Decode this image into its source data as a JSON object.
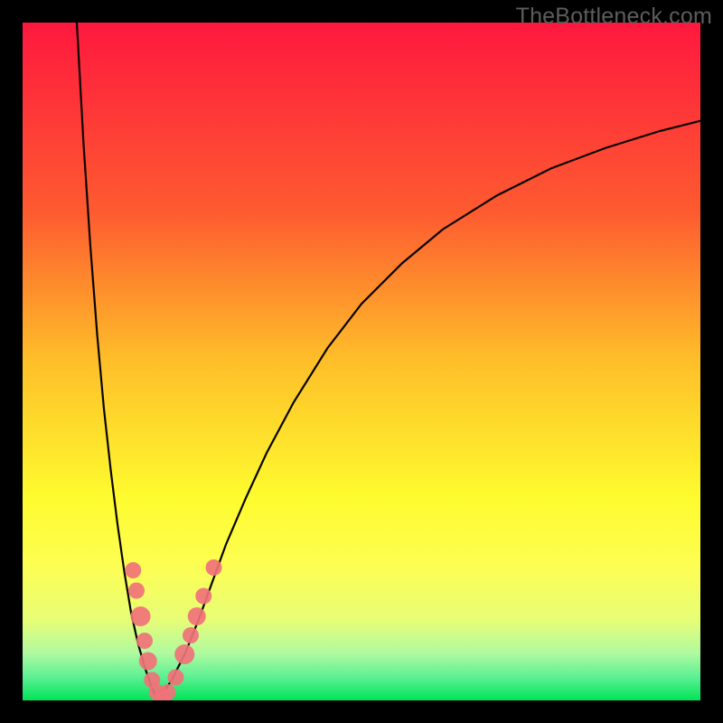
{
  "watermark": {
    "text": "TheBottleneck.com"
  },
  "colors": {
    "top": "#fe183e",
    "orange": "#fd8d27",
    "yellow": "#fefb2e",
    "pale": "#d5fc8a",
    "green": "#00e457",
    "curve": "#070400",
    "marker_fill": "#f07279",
    "marker_stroke": "#e05a62",
    "frame": "#000000"
  },
  "chart_data": {
    "type": "line",
    "title": "",
    "xlabel": "",
    "ylabel": "",
    "xlim": [
      0,
      100
    ],
    "ylim": [
      0,
      100
    ],
    "notch_x": 20,
    "series": [
      {
        "name": "left-branch",
        "x": [
          8,
          9,
          10,
          11,
          12,
          13,
          14,
          15,
          16,
          17,
          18,
          19,
          20
        ],
        "y": [
          100,
          82,
          67,
          54,
          43,
          34,
          26,
          19,
          13,
          8.5,
          5,
          2,
          0
        ]
      },
      {
        "name": "right-branch",
        "x": [
          20,
          22,
          24,
          26,
          28,
          30,
          33,
          36,
          40,
          45,
          50,
          56,
          62,
          70,
          78,
          86,
          94,
          100
        ],
        "y": [
          0,
          3,
          7,
          12,
          17.5,
          23,
          30,
          36.5,
          44,
          52,
          58.5,
          64.5,
          69.5,
          74.5,
          78.5,
          81.5,
          84,
          85.5
        ]
      }
    ],
    "markers": [
      {
        "x": 16.3,
        "y": 19.2,
        "r": 9
      },
      {
        "x": 16.8,
        "y": 16.2,
        "r": 9
      },
      {
        "x": 17.4,
        "y": 12.4,
        "r": 11
      },
      {
        "x": 18.0,
        "y": 8.8,
        "r": 9
      },
      {
        "x": 18.5,
        "y": 5.8,
        "r": 10
      },
      {
        "x": 19.1,
        "y": 3.0,
        "r": 9
      },
      {
        "x": 19.8,
        "y": 1.2,
        "r": 9
      },
      {
        "x": 20.6,
        "y": 0.6,
        "r": 9
      },
      {
        "x": 21.4,
        "y": 1.2,
        "r": 9
      },
      {
        "x": 22.6,
        "y": 3.4,
        "r": 9
      },
      {
        "x": 23.9,
        "y": 6.8,
        "r": 11
      },
      {
        "x": 24.8,
        "y": 9.6,
        "r": 9
      },
      {
        "x": 25.7,
        "y": 12.4,
        "r": 10
      },
      {
        "x": 26.7,
        "y": 15.4,
        "r": 9
      },
      {
        "x": 28.2,
        "y": 19.6,
        "r": 9
      }
    ],
    "gradient_stops": [
      {
        "offset": 0.0,
        "color": "#fe183e"
      },
      {
        "offset": 0.28,
        "color": "#fe5b30"
      },
      {
        "offset": 0.5,
        "color": "#febf29"
      },
      {
        "offset": 0.7,
        "color": "#fefb2e"
      },
      {
        "offset": 0.8,
        "color": "#fdfe52"
      },
      {
        "offset": 0.88,
        "color": "#e8fd76"
      },
      {
        "offset": 0.93,
        "color": "#b0fa9f"
      },
      {
        "offset": 0.965,
        "color": "#5ef094"
      },
      {
        "offset": 1.0,
        "color": "#00e457"
      }
    ]
  }
}
